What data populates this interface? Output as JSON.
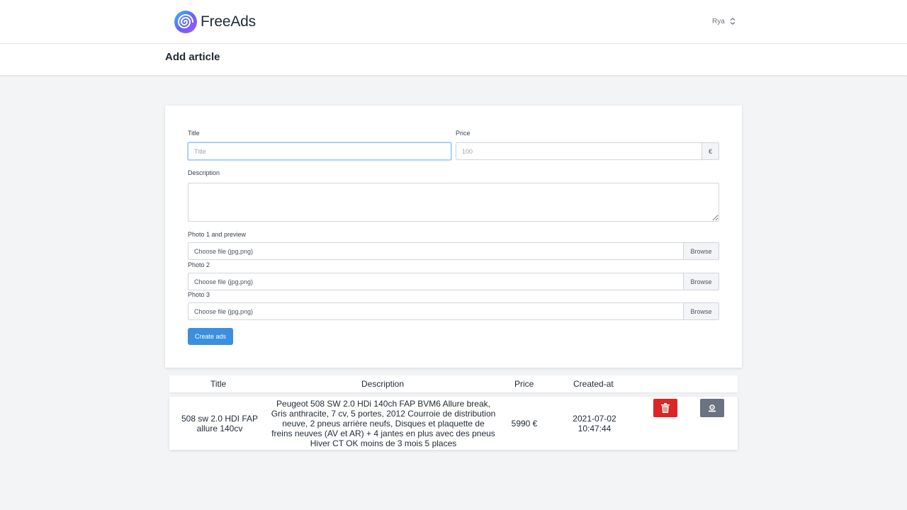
{
  "app": {
    "name": "FreeAds"
  },
  "user": {
    "name": "Rya"
  },
  "page": {
    "title": "Add article"
  },
  "form": {
    "title_label": "Title",
    "title_placeholder": "Title",
    "price_label": "Price",
    "price_placeholder": "100",
    "currency": "€",
    "description_label": "Description",
    "photos": [
      {
        "label": "Photo 1 and preview",
        "placeholder": "Choose file (jpg,png)",
        "browse": "Browse"
      },
      {
        "label": "Photo 2",
        "placeholder": "Choose file (jpg,png)",
        "browse": "Browse"
      },
      {
        "label": "Photo 3",
        "placeholder": "Choose file (jpg,png)",
        "browse": "Browse"
      }
    ],
    "submit_label": "Create ads"
  },
  "table": {
    "headers": [
      "Title",
      "Description",
      "Price",
      "Created-at"
    ],
    "rows": [
      {
        "title": "508 sw 2.0 HDI FAP allure 140cv",
        "description": "Peugeot 508 SW 2.0 HDi 140ch FAP BVM6 Allure break, Gris anthracite, 7 cv, 5 portes, 2012 Courroie de distribution neuve, 2 pneus arrière neufs, Disques et plaquette de freins neuves (AV et AR) + 4 jantes en plus avec des pneus Hiver CT OK moins de 3 mois 5 places",
        "price": "5990 €",
        "created_at": "2021-07-02 10:47:44"
      }
    ]
  },
  "icons": {
    "logo": "spiral-logo-icon",
    "user_menu": "chevron-up-down-icon",
    "delete": "trash-icon",
    "edit": "edit-icon"
  },
  "colors": {
    "primary": "#3b8fe0",
    "danger": "#dc2626",
    "secondary": "#6b7280"
  }
}
